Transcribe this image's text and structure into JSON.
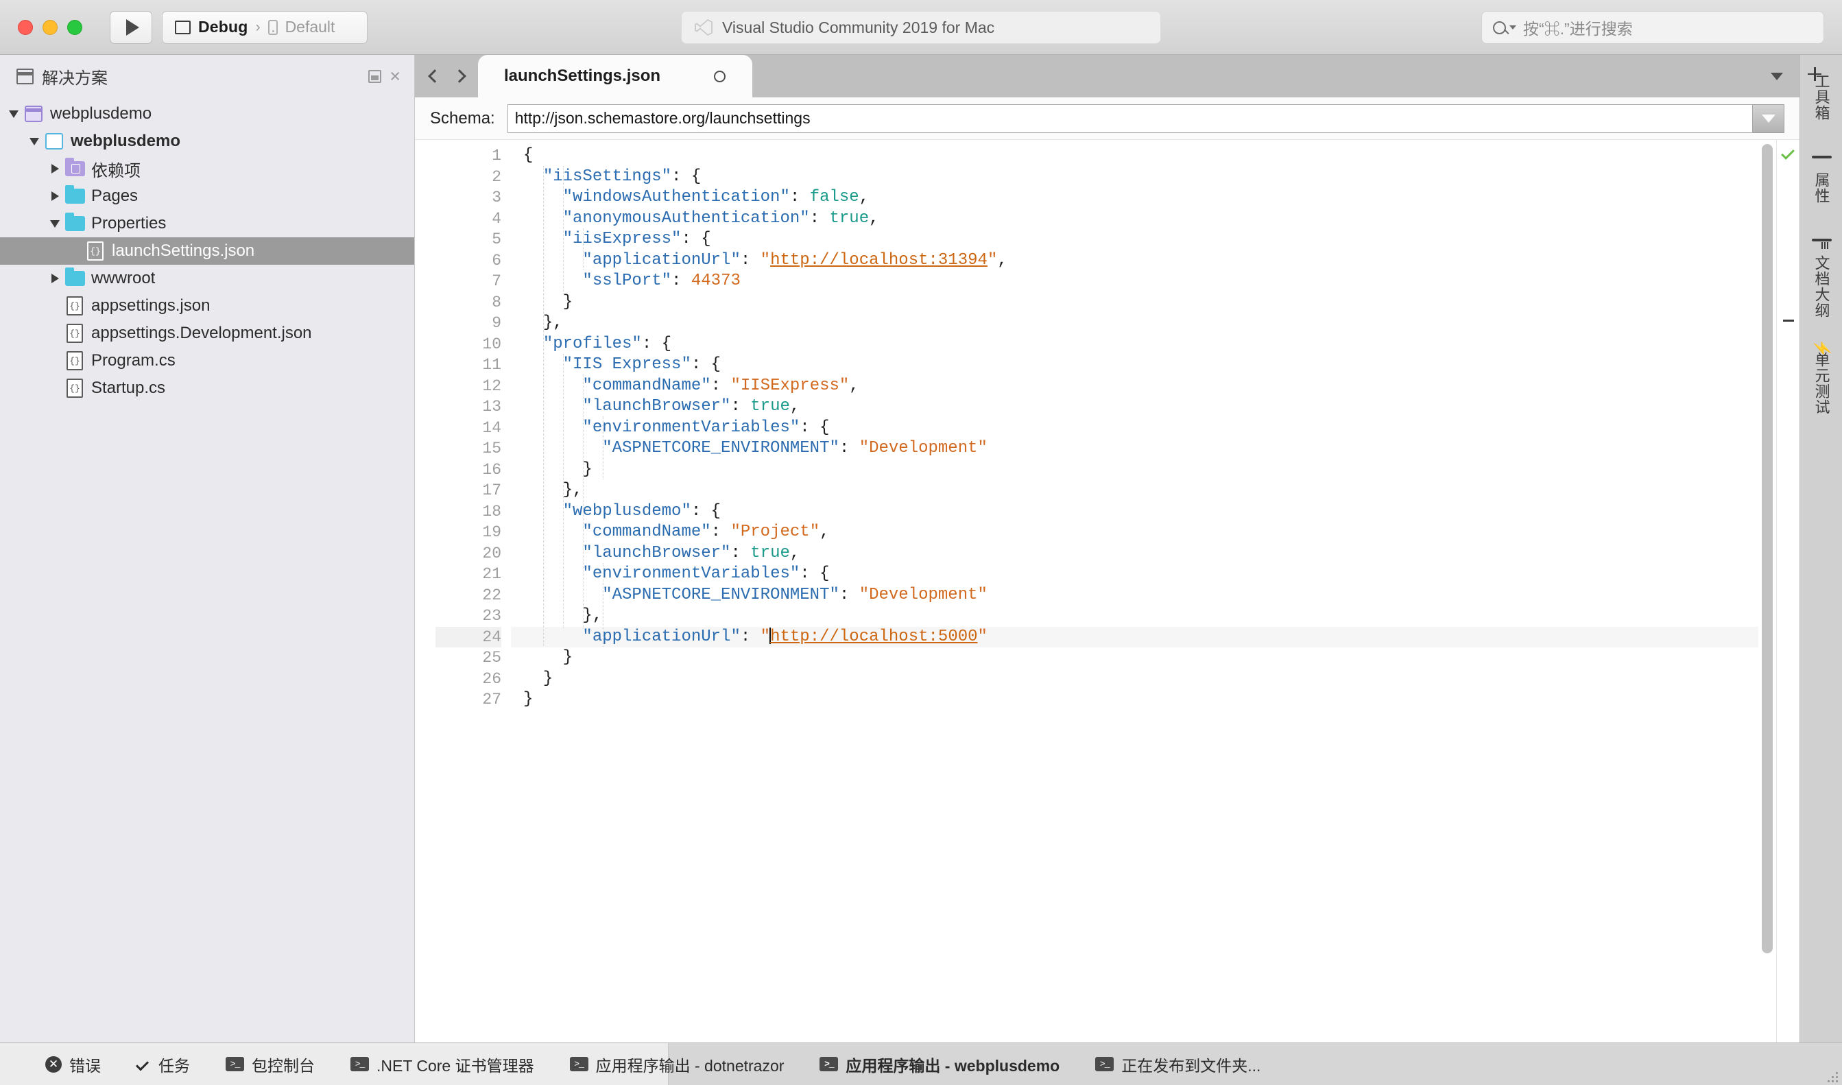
{
  "titlebar": {
    "traffic_lights": [
      "close",
      "minimize",
      "zoom"
    ],
    "run_button": "run-icon",
    "config": {
      "configuration": "Debug",
      "separator": "›",
      "target": "Default"
    },
    "center_title": "Visual Studio Community 2019 for Mac",
    "search_placeholder": "按“⌘.”进行搜索"
  },
  "solution_pad": {
    "title": "解决方案",
    "dock_button": "dock",
    "close_button": "×",
    "tree": [
      {
        "label": "webplusdemo",
        "indent": 0,
        "twisty": "down",
        "icon": "solution",
        "selected": false,
        "bold": false
      },
      {
        "label": "webplusdemo",
        "indent": 1,
        "twisty": "down",
        "icon": "project",
        "selected": false,
        "bold": true
      },
      {
        "label": "依赖项",
        "indent": 2,
        "twisty": "right",
        "icon": "dependencies",
        "selected": false,
        "bold": false
      },
      {
        "label": "Pages",
        "indent": 2,
        "twisty": "right",
        "icon": "folder",
        "selected": false,
        "bold": false
      },
      {
        "label": "Properties",
        "indent": 2,
        "twisty": "down",
        "icon": "folder",
        "selected": false,
        "bold": false
      },
      {
        "label": "launchSettings.json",
        "indent": 3,
        "twisty": "none",
        "icon": "json-file",
        "selected": true,
        "bold": false
      },
      {
        "label": "wwwroot",
        "indent": 2,
        "twisty": "right",
        "icon": "folder",
        "selected": false,
        "bold": false
      },
      {
        "label": "appsettings.json",
        "indent": 2,
        "twisty": "none",
        "icon": "json-file",
        "selected": false,
        "bold": false
      },
      {
        "label": "appsettings.Development.json",
        "indent": 2,
        "twisty": "none",
        "icon": "json-file",
        "selected": false,
        "bold": false
      },
      {
        "label": "Program.cs",
        "indent": 2,
        "twisty": "none",
        "icon": "json-file",
        "selected": false,
        "bold": false
      },
      {
        "label": "Startup.cs",
        "indent": 2,
        "twisty": "none",
        "icon": "json-file",
        "selected": false,
        "bold": false
      }
    ]
  },
  "editor": {
    "tab": {
      "label": "launchSettings.json",
      "modified_indicator": "○"
    },
    "nav_back": "‹",
    "nav_forward": "›",
    "tabstrip_menu": "chevron-down",
    "schema": {
      "label": "Schema:",
      "value": "http://json.schemastore.org/launchsettings"
    },
    "current_line": 24,
    "lines": [
      {
        "n": 1,
        "indent": 0,
        "tokens": [
          {
            "t": "punct",
            "v": "{"
          }
        ]
      },
      {
        "n": 2,
        "indent": 1,
        "tokens": [
          {
            "t": "key",
            "v": "\"iisSettings\""
          },
          {
            "t": "punct",
            "v": ": {"
          }
        ]
      },
      {
        "n": 3,
        "indent": 2,
        "tokens": [
          {
            "t": "key",
            "v": "\"windowsAuthentication\""
          },
          {
            "t": "punct",
            "v": ": "
          },
          {
            "t": "bool",
            "v": "false"
          },
          {
            "t": "punct",
            "v": ","
          }
        ]
      },
      {
        "n": 4,
        "indent": 2,
        "tokens": [
          {
            "t": "key",
            "v": "\"anonymousAuthentication\""
          },
          {
            "t": "punct",
            "v": ": "
          },
          {
            "t": "bool",
            "v": "true"
          },
          {
            "t": "punct",
            "v": ","
          }
        ]
      },
      {
        "n": 5,
        "indent": 2,
        "tokens": [
          {
            "t": "key",
            "v": "\"iisExpress\""
          },
          {
            "t": "punct",
            "v": ": {"
          }
        ]
      },
      {
        "n": 6,
        "indent": 3,
        "tokens": [
          {
            "t": "key",
            "v": "\"applicationUrl\""
          },
          {
            "t": "punct",
            "v": ": "
          },
          {
            "t": "str",
            "v": "\""
          },
          {
            "t": "url",
            "v": "http://localhost:31394"
          },
          {
            "t": "str",
            "v": "\""
          },
          {
            "t": "punct",
            "v": ","
          }
        ]
      },
      {
        "n": 7,
        "indent": 3,
        "tokens": [
          {
            "t": "key",
            "v": "\"sslPort\""
          },
          {
            "t": "punct",
            "v": ": "
          },
          {
            "t": "num",
            "v": "44373"
          }
        ]
      },
      {
        "n": 8,
        "indent": 2,
        "tokens": [
          {
            "t": "punct",
            "v": "}"
          }
        ]
      },
      {
        "n": 9,
        "indent": 1,
        "tokens": [
          {
            "t": "punct",
            "v": "},"
          }
        ]
      },
      {
        "n": 10,
        "indent": 1,
        "tokens": [
          {
            "t": "key",
            "v": "\"profiles\""
          },
          {
            "t": "punct",
            "v": ": {"
          }
        ]
      },
      {
        "n": 11,
        "indent": 2,
        "tokens": [
          {
            "t": "key",
            "v": "\"IIS Express\""
          },
          {
            "t": "punct",
            "v": ": {"
          }
        ]
      },
      {
        "n": 12,
        "indent": 3,
        "tokens": [
          {
            "t": "key",
            "v": "\"commandName\""
          },
          {
            "t": "punct",
            "v": ": "
          },
          {
            "t": "str",
            "v": "\"IISExpress\""
          },
          {
            "t": "punct",
            "v": ","
          }
        ]
      },
      {
        "n": 13,
        "indent": 3,
        "tokens": [
          {
            "t": "key",
            "v": "\"launchBrowser\""
          },
          {
            "t": "punct",
            "v": ": "
          },
          {
            "t": "bool",
            "v": "true"
          },
          {
            "t": "punct",
            "v": ","
          }
        ]
      },
      {
        "n": 14,
        "indent": 3,
        "tokens": [
          {
            "t": "key",
            "v": "\"environmentVariables\""
          },
          {
            "t": "punct",
            "v": ": {"
          }
        ]
      },
      {
        "n": 15,
        "indent": 4,
        "tokens": [
          {
            "t": "key",
            "v": "\"ASPNETCORE_ENVIRONMENT\""
          },
          {
            "t": "punct",
            "v": ": "
          },
          {
            "t": "str",
            "v": "\"Development\""
          }
        ]
      },
      {
        "n": 16,
        "indent": 3,
        "tokens": [
          {
            "t": "punct",
            "v": "}"
          }
        ]
      },
      {
        "n": 17,
        "indent": 2,
        "tokens": [
          {
            "t": "punct",
            "v": "},"
          }
        ]
      },
      {
        "n": 18,
        "indent": 2,
        "tokens": [
          {
            "t": "key",
            "v": "\"webplusdemo\""
          },
          {
            "t": "punct",
            "v": ": {"
          }
        ]
      },
      {
        "n": 19,
        "indent": 3,
        "tokens": [
          {
            "t": "key",
            "v": "\"commandName\""
          },
          {
            "t": "punct",
            "v": ": "
          },
          {
            "t": "str",
            "v": "\"Project\""
          },
          {
            "t": "punct",
            "v": ","
          }
        ]
      },
      {
        "n": 20,
        "indent": 3,
        "tokens": [
          {
            "t": "key",
            "v": "\"launchBrowser\""
          },
          {
            "t": "punct",
            "v": ": "
          },
          {
            "t": "bool",
            "v": "true"
          },
          {
            "t": "punct",
            "v": ","
          }
        ]
      },
      {
        "n": 21,
        "indent": 3,
        "tokens": [
          {
            "t": "key",
            "v": "\"environmentVariables\""
          },
          {
            "t": "punct",
            "v": ": {"
          }
        ]
      },
      {
        "n": 22,
        "indent": 4,
        "tokens": [
          {
            "t": "key",
            "v": "\"ASPNETCORE_ENVIRONMENT\""
          },
          {
            "t": "punct",
            "v": ": "
          },
          {
            "t": "str",
            "v": "\"Development\""
          }
        ]
      },
      {
        "n": 23,
        "indent": 3,
        "tokens": [
          {
            "t": "punct",
            "v": "},"
          }
        ]
      },
      {
        "n": 24,
        "indent": 3,
        "tokens": [
          {
            "t": "key",
            "v": "\"applicationUrl\""
          },
          {
            "t": "punct",
            "v": ": "
          },
          {
            "t": "str",
            "v": "\""
          },
          {
            "t": "caret",
            "v": ""
          },
          {
            "t": "url",
            "v": "http://localhost:5000"
          },
          {
            "t": "str",
            "v": "\""
          }
        ]
      },
      {
        "n": 25,
        "indent": 2,
        "tokens": [
          {
            "t": "punct",
            "v": "}"
          }
        ]
      },
      {
        "n": 26,
        "indent": 1,
        "tokens": [
          {
            "t": "punct",
            "v": "}"
          }
        ]
      },
      {
        "n": 27,
        "indent": 0,
        "tokens": [
          {
            "t": "punct",
            "v": "}"
          }
        ]
      }
    ],
    "status_markers": {
      "top": "check",
      "middle": "dash"
    }
  },
  "right_rail": [
    {
      "label": "工具箱",
      "icon": "toolbox-icon"
    },
    {
      "label": "属性",
      "icon": "properties-icon"
    },
    {
      "label": "文档大纲",
      "icon": "document-outline-icon"
    },
    {
      "label": "单元测试",
      "icon": "unit-test-icon"
    }
  ],
  "pads_bar": [
    {
      "label": "错误",
      "icon": "error-icon",
      "bold": false
    },
    {
      "label": "任务",
      "icon": "check-icon",
      "bold": false
    },
    {
      "label": "包控制台",
      "icon": "console-icon",
      "bold": false
    },
    {
      "label": ".NET Core 证书管理器",
      "icon": "console-icon",
      "bold": false
    },
    {
      "label": "应用程序输出 - dotnetrazor",
      "icon": "console-icon",
      "bold": false
    },
    {
      "label": "应用程序输出 - webplusdemo",
      "icon": "console-icon",
      "bold": true
    },
    {
      "label": "正在发布到文件夹...",
      "icon": "console-icon",
      "bold": false
    }
  ],
  "colors": {
    "json_key": "#2b6cb0",
    "json_string": "#d2691e",
    "json_bool": "#1a9a8a",
    "json_url": "#cc6611",
    "selection": "#9b9b9b",
    "folder": "#4cc6e0",
    "dependency": "#b09ee0",
    "status_ok": "#6cc04a"
  }
}
